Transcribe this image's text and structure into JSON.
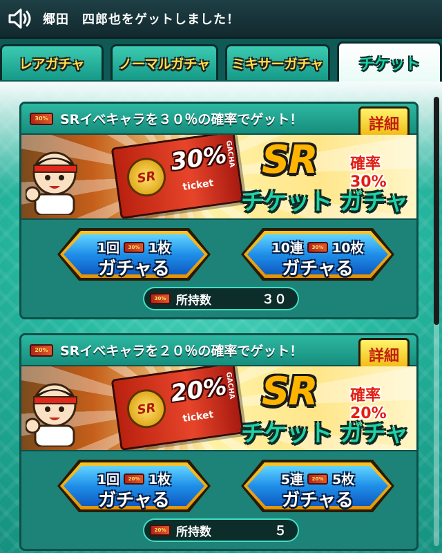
{
  "notice": {
    "icon": "speaker-icon",
    "text": "郷田　四郎也をゲットしました！"
  },
  "tabs": [
    {
      "label": "レアガチャ",
      "active": false
    },
    {
      "label": "ノーマルガチャ",
      "active": false
    },
    {
      "label": "ミキサーガチャ",
      "active": false
    },
    {
      "label": "チケット",
      "active": true
    }
  ],
  "cards": [
    {
      "title": "SRイベキャラを３０％の確率でゲット！",
      "detail_label": "詳細",
      "ticket_mini": "30%",
      "banner": {
        "ticket_sr": "SR",
        "ticket_pct": "30%",
        "ticket_word": "ticket",
        "ticket_side": "GACHA",
        "logo": "SR",
        "rate": "確率30%",
        "title": "チケット ガチャ"
      },
      "buttons": [
        {
          "count_label": "1回",
          "cost_label": "1枚",
          "action": "ガチャる"
        },
        {
          "count_label": "10連",
          "cost_label": "10枚",
          "action": "ガチャる"
        }
      ],
      "owned_label": "所持数",
      "owned_count": "３０"
    },
    {
      "title": "SRイベキャラを２０％の確率でゲット！",
      "detail_label": "詳細",
      "ticket_mini": "20%",
      "banner": {
        "ticket_sr": "SR",
        "ticket_pct": "20%",
        "ticket_word": "ticket",
        "ticket_side": "GACHA",
        "logo": "SR",
        "rate": "確率20%",
        "title": "チケット ガチャ"
      },
      "buttons": [
        {
          "count_label": "1回",
          "cost_label": "1枚",
          "action": "ガチャる"
        },
        {
          "count_label": "5連",
          "cost_label": "5枚",
          "action": "ガチャる"
        }
      ],
      "owned_label": "所持数",
      "owned_count": "５"
    }
  ],
  "colors": {
    "teal": "#1fa893",
    "tab_text": "#ffe14a",
    "active_tab_text": "#1fd1a8",
    "button_blue": "#1f8fe9",
    "rate_red": "#e01e12"
  }
}
